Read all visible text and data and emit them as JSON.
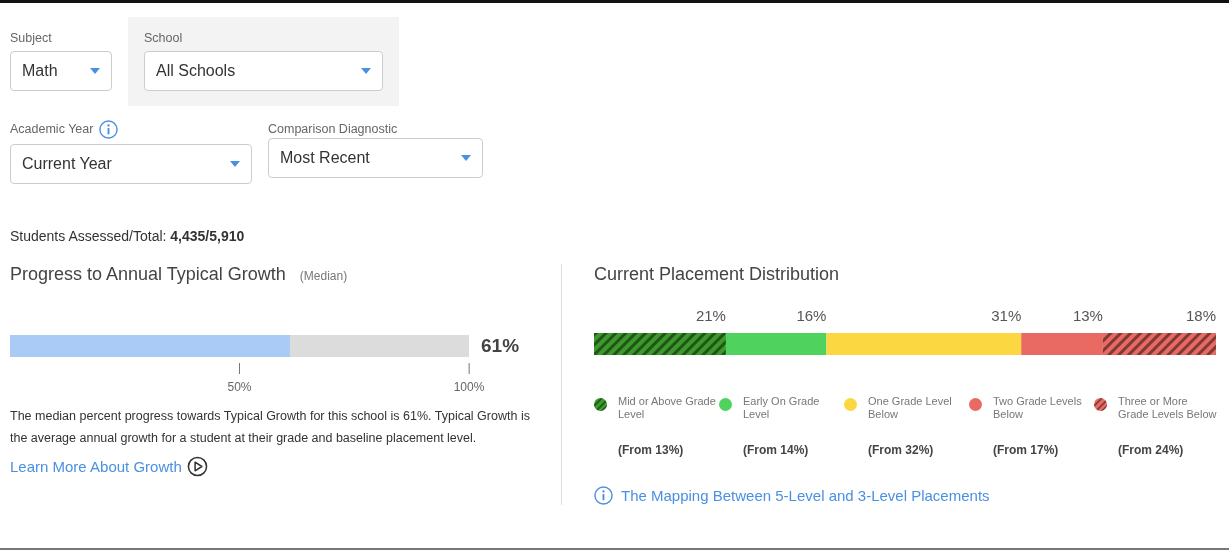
{
  "filters_row_1": [
    {
      "label": "Subject",
      "value": "Math",
      "highlighted": false
    },
    {
      "label": "School",
      "value": "All Schools",
      "highlighted": true
    }
  ],
  "filters_row_2": [
    {
      "label": "Academic Year",
      "value": "Current Year",
      "info": true
    },
    {
      "label": "Comparison Diagnostic",
      "value": "Most Recent",
      "info": false
    }
  ],
  "students": {
    "label": "Students Assessed/Total: ",
    "value": "4,435/5,910"
  },
  "progress": {
    "title": "Progress to Annual Typical Growth",
    "subtitle": "(Median)",
    "level": 0.61,
    "reading": "61%",
    "ticks": [
      "50%",
      "100%"
    ],
    "description": "The median percent progress towards Typical Growth for this school is 61%. Typical Growth is the average annual growth for a student at their grade and baseline placement level.",
    "link": "Learn More About Growth"
  },
  "placement": {
    "title": "Current Placement Distribution",
    "segments": [
      {
        "reading": "21%",
        "color": "#3c9a2c",
        "hatched": true
      },
      {
        "reading": "16%",
        "color": "#4fd25e",
        "hatched": false
      },
      {
        "reading": "31%",
        "color": "#fbd842",
        "hatched": false
      },
      {
        "reading": "13%",
        "color": "#e96a62",
        "hatched": false
      },
      {
        "reading": "18%",
        "color": "#e96a62",
        "hatched": true
      }
    ],
    "legend": [
      {
        "label": "Mid or Above Grade Level",
        "from": "(From 13%)",
        "color": "#3c9a2c",
        "hatched": true
      },
      {
        "label": "Early On Grade Level",
        "from": "(From 14%)",
        "color": "#4fd25e",
        "hatched": false
      },
      {
        "label": "One Grade Level Below",
        "from": "(From 32%)",
        "color": "#fbd842",
        "hatched": false
      },
      {
        "label": "Two Grade Levels Below",
        "from": "(From 17%)",
        "color": "#e96a62",
        "hatched": false
      },
      {
        "label": "Three or More Grade Levels Below",
        "from": "(From 24%)",
        "color": "#e96a62",
        "hatched": true
      }
    ],
    "link": "The Mapping Between 5-Level and 3-Level Placements"
  }
}
